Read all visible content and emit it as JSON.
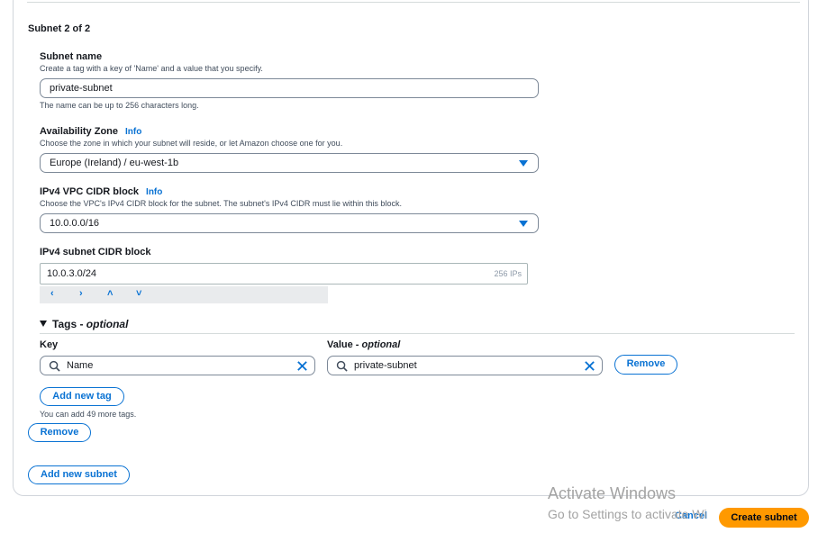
{
  "subnet_heading": "Subnet 2 of 2",
  "subnet_name": {
    "label": "Subnet name",
    "description": "Create a tag with a key of 'Name' and a value that you specify.",
    "value": "private-subnet",
    "hint": "The name can be up to 256 characters long."
  },
  "availability_zone": {
    "label": "Availability Zone",
    "info": "Info",
    "description": "Choose the zone in which your subnet will reside, or let Amazon choose one for you.",
    "value": "Europe (Ireland) / eu-west-1b"
  },
  "vpc_cidr": {
    "label": "IPv4 VPC CIDR block",
    "info": "Info",
    "description": "Choose the VPC's IPv4 CIDR block for the subnet. The subnet's IPv4 CIDR must lie within this block.",
    "value": "10.0.0.0/16"
  },
  "subnet_cidr": {
    "label": "IPv4 subnet CIDR block",
    "value": "10.0.3.0/24",
    "suffix": "256 IPs",
    "stepper": [
      "‹",
      "›",
      "˄",
      "˅"
    ]
  },
  "tags": {
    "heading": "Tags - ",
    "heading_optional": "optional",
    "key_label": "Key",
    "value_label": "Value - ",
    "value_optional": "optional",
    "key_value": "Name",
    "value_value": "private-subnet",
    "remove_tag": "Remove",
    "add_tag": "Add new tag",
    "hint": "You can add 49 more tags."
  },
  "remove_subnet": "Remove",
  "add_subnet": "Add new subnet",
  "watermark": {
    "line1": "Activate Windows",
    "line2": "Go to Settings to activate Wi"
  },
  "footer": {
    "cancel": "Cancel",
    "create": "Create subnet"
  },
  "colors": {
    "accent": "#0972d3",
    "primary": "#ff9900"
  }
}
